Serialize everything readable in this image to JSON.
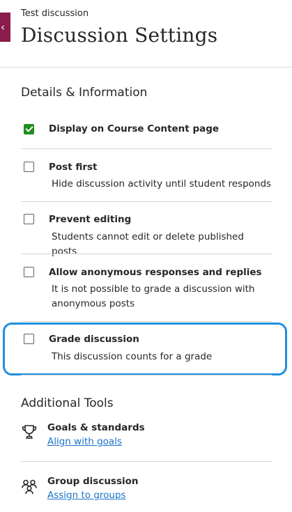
{
  "header": {
    "close_glyph": "‹",
    "subtitle": "Test discussion",
    "title": "Discussion Settings"
  },
  "details": {
    "heading": "Details & Information",
    "options": [
      {
        "label": "Display on Course Content page",
        "description": "",
        "checked": true
      },
      {
        "label": "Post first",
        "description": "Hide discussion activity until student responds",
        "checked": false
      },
      {
        "label": "Prevent editing",
        "description": "Students cannot edit or delete published posts",
        "checked": false
      },
      {
        "label": "Allow anonymous responses and replies",
        "description": "It is not possible to grade a discussion with anonymous posts",
        "checked": false
      },
      {
        "label": "Grade discussion",
        "description": "This discussion counts for a grade",
        "checked": false
      }
    ]
  },
  "tools": {
    "heading": "Additional Tools",
    "items": [
      {
        "title": "Goals & standards",
        "link": "Align with goals",
        "icon": "trophy-icon"
      },
      {
        "title": "Group discussion",
        "link": "Assign to groups",
        "icon": "group-icon"
      }
    ]
  },
  "colors": {
    "close_tab": "#8a1b4a",
    "checkbox_checked": "#228b22",
    "focus_ring": "#1f8fe0",
    "link": "#1a73c9"
  }
}
